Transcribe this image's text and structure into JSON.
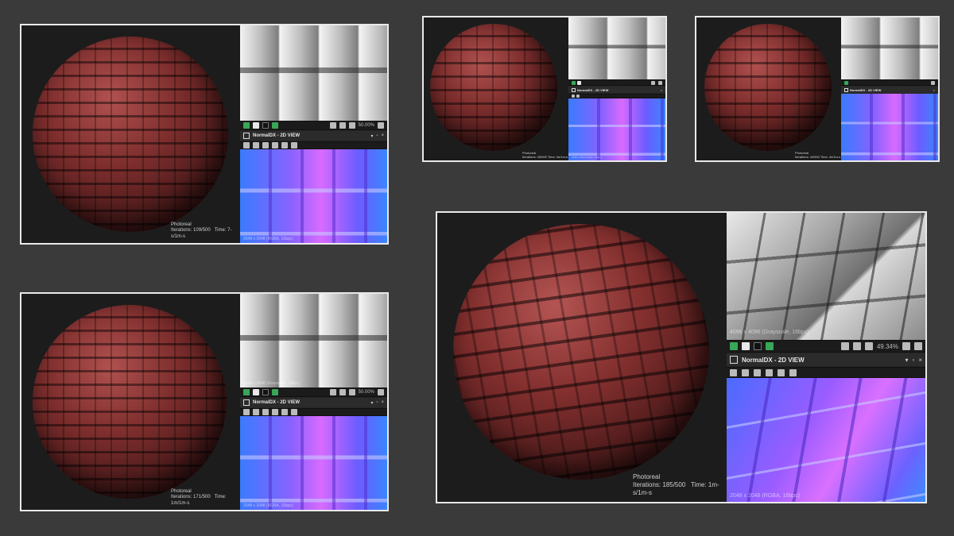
{
  "cards": [
    {
      "id": "top-left",
      "render_mode": "Photoreal",
      "iterations": "Iterations: 109/500",
      "time": "Time: 7-s/1m-s",
      "zoom": "50.00%",
      "panel_title": "NormalDX - 2D VIEW",
      "gray_resolution": "",
      "normal_resolution": "2048 x 2048 (RGBA, 16bpc)"
    },
    {
      "id": "top-middle",
      "render_mode": "Photoreal",
      "iterations": "Iterations: 45/500",
      "time": "Time: 4s/1m-s",
      "zoom": "",
      "panel_title": "NormalDX - 2D VIEW",
      "gray_resolution": "",
      "normal_resolution": "2048 x 2048 (RGBA, 16bpc)"
    },
    {
      "id": "top-right",
      "render_mode": "Photoreal",
      "iterations": "Iterations: 44/500",
      "time": "Time: 4s/1m-s",
      "zoom": "",
      "panel_title": "NormalDX - 2D VIEW",
      "gray_resolution": "",
      "normal_resolution": ""
    },
    {
      "id": "bottom-left",
      "render_mode": "Photoreal",
      "iterations": "Iterations: 171/500",
      "time": "Time: 1m/1m-s",
      "zoom": "50.00%",
      "panel_title": "NormalDX - 2D VIEW",
      "gray_resolution": "2048 x 2048 (Grayscale, 16bpc)",
      "normal_resolution": "2048 x 2048 (RGBA, 16bpc)"
    },
    {
      "id": "bottom-right",
      "render_mode": "Photoreal",
      "iterations": "Iterations: 185/500",
      "time": "Time: 1m-s/1m-s",
      "zoom": "49.34%",
      "panel_title": "NormalDX - 2D VIEW",
      "gray_resolution": "4096 x 4096 (Grayscale, 16bpc)",
      "normal_resolution": "2048 x 2048 (RGBA, 16bpc)"
    }
  ],
  "colors": {
    "background": "#3a3a3b",
    "card_border": "#e9e9e9",
    "tile_red": "#7d2e2d",
    "toolbar_accent": "#3aa657"
  },
  "icons": [
    "layers-icon",
    "channel-icon",
    "grid-icon",
    "tile-icon",
    "fit-icon",
    "histogram-icon",
    "info-icon",
    "lock-icon",
    "save-icon",
    "pin-icon",
    "close-icon"
  ]
}
